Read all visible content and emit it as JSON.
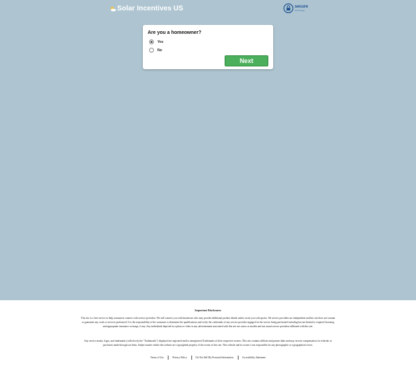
{
  "header": {
    "brand": "Solar Incentives US",
    "brand_icon": "sun-cloud-icon",
    "secure_badge": {
      "main": "secure",
      "sub": "technology",
      "icon": "lock-icon"
    }
  },
  "card": {
    "question": "Are you a homeowner?",
    "options": [
      {
        "label": "Yes",
        "selected": true
      },
      {
        "label": "No",
        "selected": false
      }
    ],
    "next_label": "Next"
  },
  "footer": {
    "title": "Important Disclosures",
    "paragraph1": "This site is a free service to help consumers connect with service providers. We will connect you with businesses who may provide additional product details and/or assist you with quotes. All service providers are independent and this site does not warrant or guarantee any work or services performed. It is the responsibility of the consumer to determine the qualifications and verify the credentials of any service provider engaged for the service being performed including but not limited to required licensing and appropriate insurance coverage, if any. Any individuals depicted in a photo or video in any advertisement associated with this site are actors or models and not actual service providers affiliated with this site.",
    "paragraph2": "Any service marks, logos, and trademarks (collectively the \"Trademarks\") displayed are registered and/or unregistered Trademarks of their respective owners. This site contains affiliate and partner links and may receive compensation for referrals or purchases made through our links. Subject matter within this website are copyrighted property of the owner of this site. This website and its owner is not responsible for any photographic or typographical errors.",
    "links": [
      "Terms of Use",
      "Privacy Policy",
      "Do Not Sell My Personal Information",
      "Accessibility Statement"
    ]
  },
  "colors": {
    "background": "#aec5d1",
    "button": "#4caf5c",
    "secure_blue": "#1c4f8f"
  }
}
